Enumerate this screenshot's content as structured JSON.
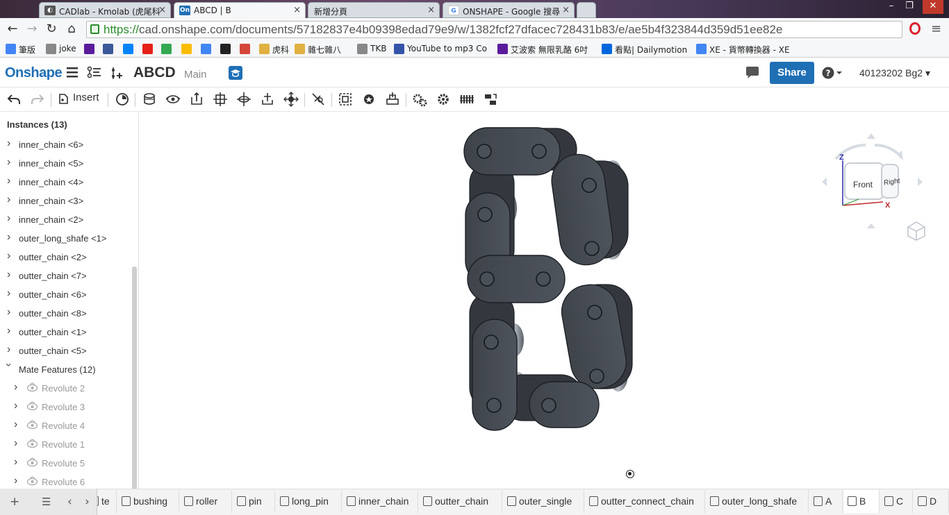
{
  "browser": {
    "tabs": [
      {
        "title": "CADlab - Kmolab (虎尾科",
        "icon": "spy-icon",
        "active": false
      },
      {
        "title": "ABCD | B",
        "icon": "onshape-favicon",
        "active": true
      },
      {
        "title": "新增分頁",
        "icon": "",
        "active": false
      },
      {
        "title": "ONSHAPE - Google 搜尋",
        "icon": "google-icon",
        "active": false
      }
    ],
    "url_https": "https://",
    "url_rest": "cad.onshape.com/documents/57182837e4b09398edad79e9/w/1382fcf27dfacec728431b83/e/ae5b4f323844d359d51ee82e",
    "bookmarks": [
      {
        "label": "筆版",
        "icon": "google-icon",
        "color": "#4285f4"
      },
      {
        "label": "joke",
        "icon": "page-icon",
        "color": "#888"
      },
      {
        "label": "",
        "icon": "yahoo-icon",
        "color": "#5b1c9c"
      },
      {
        "label": "",
        "icon": "facebook-icon",
        "color": "#3b5998"
      },
      {
        "label": "",
        "icon": "messenger-icon",
        "color": "#0084ff"
      },
      {
        "label": "",
        "icon": "youtube-icon",
        "color": "#e62117"
      },
      {
        "label": "",
        "icon": "maps-icon",
        "color": "#34a853"
      },
      {
        "label": "",
        "icon": "drive-icon",
        "color": "#fbbc05"
      },
      {
        "label": "",
        "icon": "translate-icon",
        "color": "#4285f4"
      },
      {
        "label": "",
        "icon": "c-icon",
        "color": "#222"
      },
      {
        "label": "",
        "icon": "gmail-icon",
        "color": "#d44638"
      },
      {
        "label": "虎科",
        "icon": "folder-icon",
        "color": "#e0b040"
      },
      {
        "label": "雜七雜八",
        "icon": "folder-icon",
        "color": "#e0b040"
      },
      {
        "label": "TKB",
        "icon": "page-icon",
        "color": "#888"
      },
      {
        "label": "YouTube to mp3 Co",
        "icon": "mp3-icon",
        "color": "#3355aa"
      },
      {
        "label": "艾波索 無限乳酪 6吋",
        "icon": "yahoo-icon",
        "color": "#5b1c9c"
      },
      {
        "label": "看點| Dailymotion",
        "icon": "dailymotion-icon",
        "color": "#0066dc"
      },
      {
        "label": "XE - 貨幣轉換器 - XE",
        "icon": "google-icon",
        "color": "#4285f4"
      }
    ]
  },
  "app": {
    "logo": "Onshape",
    "doc_title": "ABCD",
    "workspace": "Main",
    "share_label": "Share",
    "user_label": "40123202 Bg2 ▾",
    "insert_label": "Insert"
  },
  "sidebar": {
    "instances_header": "Instances (13)",
    "instances": [
      "inner_chain <6>",
      "inner_chain <5>",
      "inner_chain <4>",
      "inner_chain <3>",
      "inner_chain <2>",
      "outer_long_shafe <1>",
      "outter_chain <2>",
      "outter_chain <7>",
      "outter_chain <6>",
      "outter_chain <8>",
      "outter_chain <1>",
      "outter_chain <5>"
    ],
    "mate_header": "Mate Features (12)",
    "mates": [
      "Revolute 2",
      "Revolute 3",
      "Revolute 4",
      "Revolute 1",
      "Revolute 5",
      "Revolute 6"
    ]
  },
  "viewcube": {
    "front": "Front",
    "right": "Right",
    "z": "Z",
    "x": "X"
  },
  "bottom_tabs": [
    {
      "label": "te",
      "active": false
    },
    {
      "label": "bushing",
      "active": false
    },
    {
      "label": "roller",
      "active": false
    },
    {
      "label": "pin",
      "active": false
    },
    {
      "label": "long_pin",
      "active": false
    },
    {
      "label": "inner_chain",
      "active": false
    },
    {
      "label": "outter_chain",
      "active": false
    },
    {
      "label": "outer_single",
      "active": false
    },
    {
      "label": "outter_connect_chain",
      "active": false
    },
    {
      "label": "outer_long_shafe",
      "active": false
    },
    {
      "label": "A",
      "active": false
    },
    {
      "label": "B",
      "active": true
    },
    {
      "label": "C",
      "active": false
    },
    {
      "label": "D",
      "active": false
    }
  ]
}
